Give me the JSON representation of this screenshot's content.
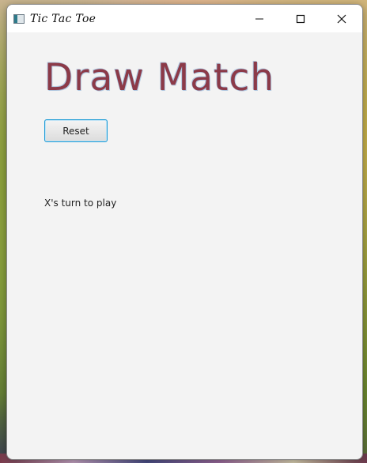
{
  "window": {
    "title": "Tic Tac Toe"
  },
  "caption_buttons": {
    "minimize_icon": "minimize-icon",
    "maximize_icon": "maximize-icon",
    "close_icon": "close-icon"
  },
  "main": {
    "headline": "Draw Match",
    "reset_label": "Reset",
    "status": "X's turn to play"
  },
  "colors": {
    "headline": "#8c3a48",
    "headline_glow": "#8fb3d6",
    "window_background": "#f3f3f3",
    "button_focus_border": "#1a9ad6"
  }
}
